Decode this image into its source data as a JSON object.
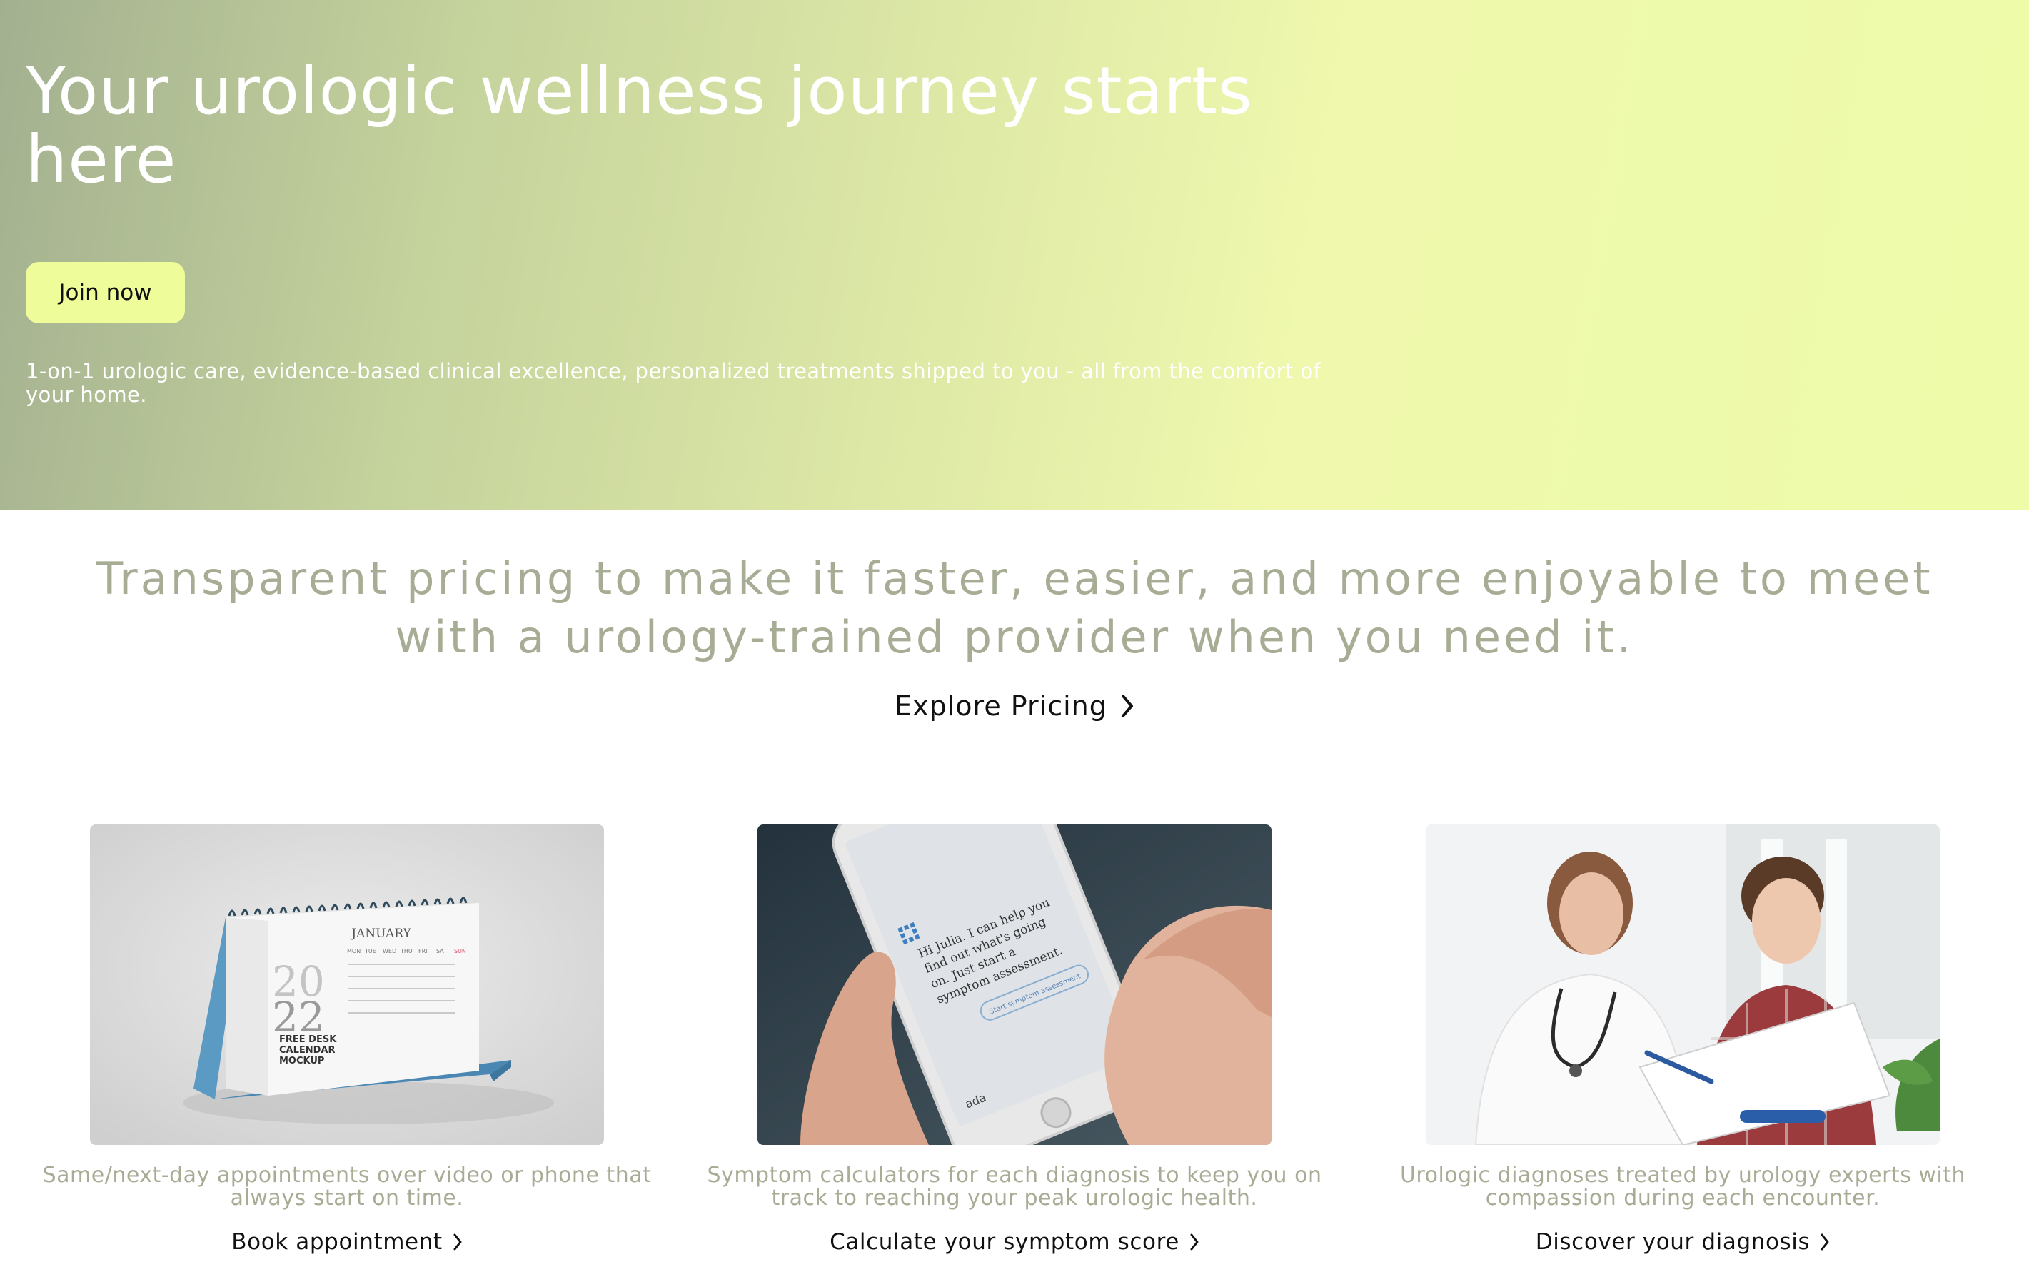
{
  "hero": {
    "title": "Your urologic wellness journey starts here",
    "cta_label": "Join now",
    "subtitle": "1-on-1 urologic care, evidence-based clinical excellence, personalized treatments shipped to you - all from the comfort of your home."
  },
  "pricing": {
    "headline": "Transparent pricing to make it faster, easier, and more enjoyable to meet with a urology-trained provider when you need it.",
    "link_label": "Explore Pricing",
    "link_icon": "chevron-right-icon"
  },
  "calendar_photo": {
    "month": "JANUARY",
    "year_top": "20",
    "year_bottom": "22",
    "line1": "FREE DESK",
    "line2": "CALENDAR",
    "line3": "MOCKUP",
    "days": [
      "MON",
      "TUE",
      "WED",
      "THU",
      "FRI",
      "SAT",
      "SUN"
    ]
  },
  "phone_photo": {
    "message_line1": "Hi Julia. I can help you",
    "message_line2": "find out what's going",
    "message_line3": "on. Just start a",
    "message_line4": "symptom assessment.",
    "button": "Start symptom assessment",
    "brand": "ada"
  },
  "cards": [
    {
      "image": "desk-calendar-photo",
      "text": "Same/next-day appointments over video or phone that always start on time.",
      "link_label": "Book appointment"
    },
    {
      "image": "phone-symptom-app-photo",
      "text": "Symptom calculators for each diagnosis to keep you on track to reaching your peak urologic health.",
      "link_label": "Calculate your symptom score"
    },
    {
      "image": "doctor-patient-photo",
      "text": "Urologic diagnoses treated by urology experts with compassion during each encounter.",
      "link_label": "Discover your diagnosis"
    }
  ],
  "colors": {
    "accent_button": "#eefc9a",
    "muted_text": "#a6ad94",
    "hero_gradient_start": "#a3b090",
    "hero_gradient_end": "#eefca9"
  }
}
